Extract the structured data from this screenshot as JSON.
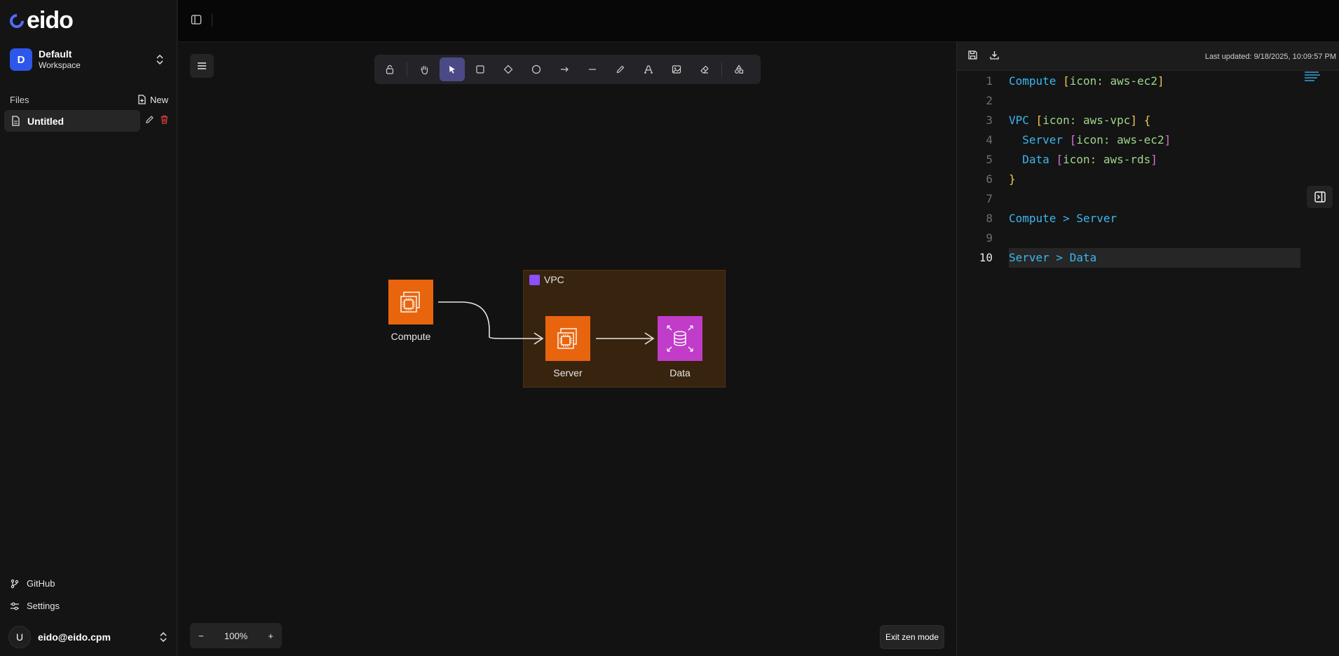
{
  "app": {
    "logo_text": "eido"
  },
  "workspace": {
    "avatar_letter": "D",
    "name": "Default",
    "subtitle": "Workspace"
  },
  "files": {
    "header": "Files",
    "new_label": "New",
    "items": [
      {
        "label": "Untitled"
      }
    ]
  },
  "nav": {
    "github": "GitHub",
    "settings": "Settings"
  },
  "user": {
    "avatar_letter": "U",
    "email": "eido@eido.cpm"
  },
  "toolbar": {
    "tools": [
      "lock-icon",
      "hand-icon",
      "pointer-icon",
      "rectangle-icon",
      "diamond-icon",
      "ellipse-icon",
      "arrow-icon",
      "line-icon",
      "pencil-icon",
      "text-icon",
      "image-icon",
      "eraser-icon",
      "shapes-icon"
    ],
    "active_tool": "pointer-icon"
  },
  "zoom": {
    "minus": "−",
    "level": "100%",
    "plus": "+"
  },
  "exit_zen": "Exit zen mode",
  "diagram": {
    "group": {
      "label": "VPC"
    },
    "nodes": [
      {
        "label": "Compute",
        "icon": "aws-ec2-icon"
      },
      {
        "label": "Server",
        "icon": "aws-ec2-icon"
      },
      {
        "label": "Data",
        "icon": "aws-rds-icon"
      }
    ]
  },
  "editor": {
    "last_updated": "Last updated: 9/18/2025, 10:09:57 PM",
    "current_line": 10,
    "lines": [
      {
        "n": "1",
        "text": "Compute [icon: aws-ec2]"
      },
      {
        "n": "2",
        "text": ""
      },
      {
        "n": "3",
        "text": "VPC [icon: aws-vpc] {"
      },
      {
        "n": "4",
        "text": "  Server [icon: aws-ec2]"
      },
      {
        "n": "5",
        "text": "  Data [icon: aws-rds]"
      },
      {
        "n": "6",
        "text": "}"
      },
      {
        "n": "7",
        "text": ""
      },
      {
        "n": "8",
        "text": "Compute > Server"
      },
      {
        "n": "9",
        "text": ""
      },
      {
        "n": "10",
        "text": "Server > Data"
      }
    ]
  },
  "colors": {
    "accent": "#2d57ea",
    "active_tool": "#4b4a86",
    "ec2": "#e8650e",
    "rds": "#c13cc9",
    "vpc_fill": "#38230f"
  }
}
